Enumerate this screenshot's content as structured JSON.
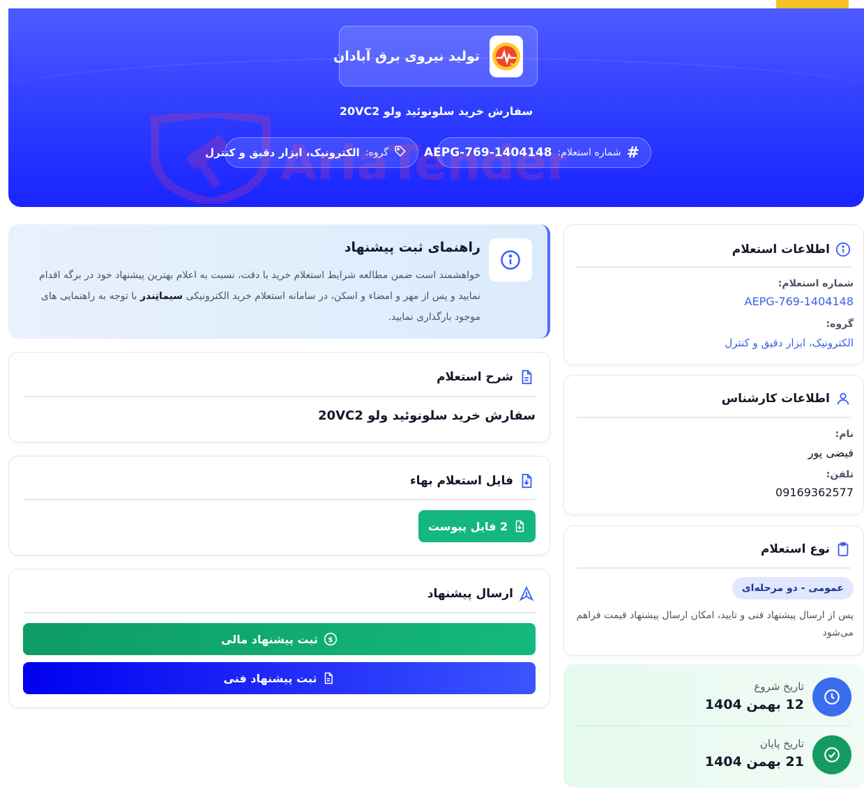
{
  "header": {
    "company_name": "تولید نیروی برق آبادان",
    "subtitle": "سفارش خرید سلونوئید ولو 20VC2",
    "inquiry_number_label": "شماره استعلام:",
    "inquiry_number": "AEPG-769-1404148",
    "group_label": "گروه:",
    "group_value": "الکترونیک، ابزار دقیق و کنترل",
    "watermark": "AriaTender.neT"
  },
  "guide": {
    "title": "راهنمای ثبت پیشنهاد",
    "text_1": "خواهشمند است ضمن مطالعه شرایط استعلام خرید با دقت، نسبت به اعلام بهترین پیشنهاد خود در برگه اقدام نمایید و پس از مهر و امضاء و اسکن، در سامانه استعلام خرید الکترونیکی",
    "text_bold": "سیماتِندر",
    "text_2": "با توجه به راهنمایی های موجود بارگذاری نمایید."
  },
  "description": {
    "title": "شرح استعلام",
    "text": "سفارش خرید سلونوئید ولو 20VC2"
  },
  "files": {
    "title": "فایل استعلام بهاء",
    "button_label": "2 فایل پیوست"
  },
  "submit": {
    "title": "ارسال پیشنهاد",
    "financial_label": "ثبت پیشنهاد مالی",
    "technical_label": "ثبت پیشنهاد فنی"
  },
  "inquiry_info": {
    "title": "اطلاعات استعلام",
    "number_label": "شماره استعلام:",
    "number_value": "AEPG-769-1404148",
    "group_label": "گروه:",
    "group_value": "الکترونیک، ابزار دقیق و کنترل"
  },
  "expert_info": {
    "title": "اطلاعات کارشناس",
    "name_label": "نام:",
    "name_value": "فیضی پور",
    "phone_label": "تلفن:",
    "phone_value": "09169362577"
  },
  "inquiry_type": {
    "title": "نوع استعلام",
    "badge": "عمومی - دو مرحله‌ای",
    "description": "پس از ارسال پیشنهاد فنی و تایید، امکان ارسال پیشنهاد قیمت فراهم می‌شود"
  },
  "dates": {
    "start_label": "تاریخ شروع",
    "start_value": "12 بهمن 1404",
    "end_label": "تاریخ پایان",
    "end_value": "21 بهمن 1404"
  },
  "colors": {
    "primary": "#2d3bff",
    "accent_yellow": "#f6c026",
    "green": "#13b77f",
    "link_blue": "#3b62e0"
  }
}
